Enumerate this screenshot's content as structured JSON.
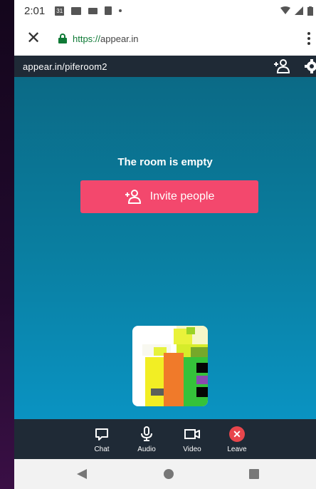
{
  "status_bar": {
    "time": "2:01",
    "calendar_day": "31"
  },
  "browser": {
    "url_scheme": "https://",
    "url_host": "appear.in"
  },
  "room": {
    "name": "appear.in/piferoom2"
  },
  "main": {
    "empty_text": "The room is empty",
    "invite_label": "Invite people"
  },
  "toolbar": {
    "chat": "Chat",
    "audio": "Audio",
    "video": "Video",
    "leave": "Leave"
  },
  "colors": {
    "accent": "#f3486d",
    "leave": "#e8464c",
    "bar": "#1f2a36",
    "secure": "#0f7a36"
  }
}
